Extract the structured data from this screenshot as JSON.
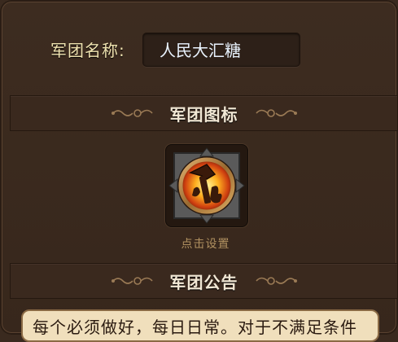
{
  "legion_name": {
    "label": "军团名称:",
    "value": "人民大汇糖"
  },
  "emblem_section": {
    "title": "军团图标",
    "tap_label": "点击设置",
    "emblem_icon": "flaming-hammer-icon"
  },
  "notice_section": {
    "title": "军团公告",
    "text": "每个必须做好，每日日常。对于不满足条件"
  },
  "colors": {
    "panel_bg": "#3a2a1f",
    "label_gold": "#f0e3b0",
    "tap_label_tan": "#b09060",
    "notice_bg": "#f0dfbc"
  }
}
